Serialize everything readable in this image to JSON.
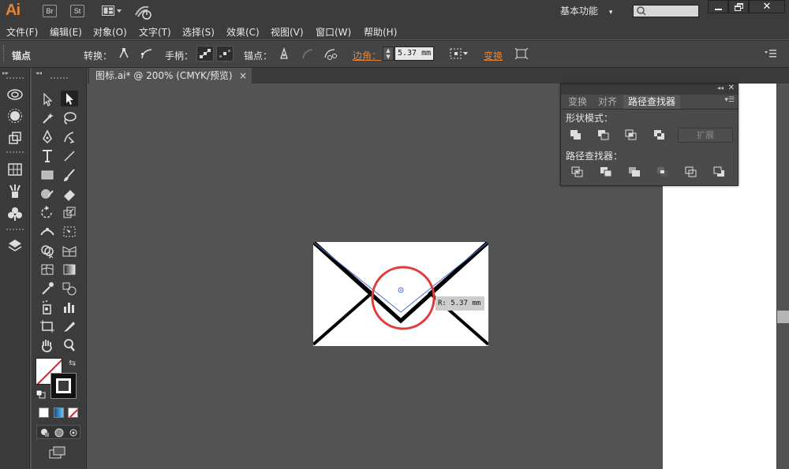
{
  "app": {
    "logo": "Ai",
    "bridge": "Br",
    "stock": "St",
    "workspace": "基本功能"
  },
  "menu": [
    "文件(F)",
    "编辑(E)",
    "对象(O)",
    "文字(T)",
    "选择(S)",
    "效果(C)",
    "视图(V)",
    "窗口(W)",
    "帮助(H)"
  ],
  "control": {
    "anchor_label": "锚点",
    "convert_label": "转换：",
    "handle_label": "手柄：",
    "anchor_point_label": "锚点：",
    "corner_label": "边角：",
    "corner_value": "5.37 mm",
    "transform_label": "变换"
  },
  "document_tab": {
    "title": "图标.ai* @ 200% (CMYK/预览)",
    "close": "×"
  },
  "pathfinder_panel": {
    "tabs": [
      "变换",
      "对齐",
      "路径查找器"
    ],
    "active_tab": "路径查找器",
    "shape_modes_label": "形状模式：",
    "expand_label": "扩展",
    "pathfinders_label": "路径查找器："
  },
  "canvas": {
    "radius_tooltip": "R: 5.37 mm"
  },
  "colors": {
    "accent_orange": "#e3853b",
    "highlight_circle": "#e03c3c",
    "path_blue": "#4a6fd8",
    "app_bg": "#535353"
  }
}
